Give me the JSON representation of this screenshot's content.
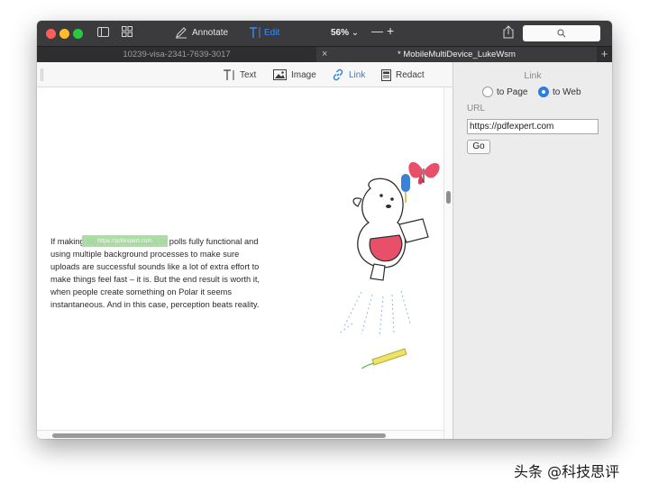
{
  "titlebar": {
    "annotate_label": "Annotate",
    "edit_label": "Edit",
    "zoom": "56%",
    "zoom_out_label": "—",
    "zoom_in_label": "+"
  },
  "tabs": [
    {
      "label": "10239-visa-2341-7639-3017"
    },
    {
      "label": "* MobileMultiDevice_LukeWsm"
    }
  ],
  "tab_close_label": "×",
  "tab_add_label": "+",
  "edit_toolbar": {
    "items": [
      {
        "label": "Text",
        "icon": "text-tool-icon"
      },
      {
        "label": "Image",
        "icon": "image-icon"
      },
      {
        "label": "Link",
        "icon": "link-icon",
        "active": true
      },
      {
        "label": "Redact",
        "icon": "redact-icon"
      }
    ]
  },
  "document": {
    "paragraph": "If making te[n]s of thousands of polls fully functional and using multiple background processes to make sure uploads are successful sounds like a lot of extra effort to make things feel fast – it is. But the end result is worth it, when people create something on Polar it seems instantaneous. And in this case, perception beats reality.",
    "link_label": "https://pdfexpert.com"
  },
  "link_panel": {
    "title": "Link",
    "options": [
      {
        "label": "to Page",
        "selected": false
      },
      {
        "label": "to Web",
        "selected": true
      }
    ],
    "url_label": "URL",
    "url_value": "https://pdfexpert.com",
    "go_label": "Go"
  },
  "colors": {
    "accent": "#2a7de1",
    "titlebar": "#3b3b3d",
    "highlight": "#a8dca0"
  },
  "watermark": "头条 @科技思评"
}
